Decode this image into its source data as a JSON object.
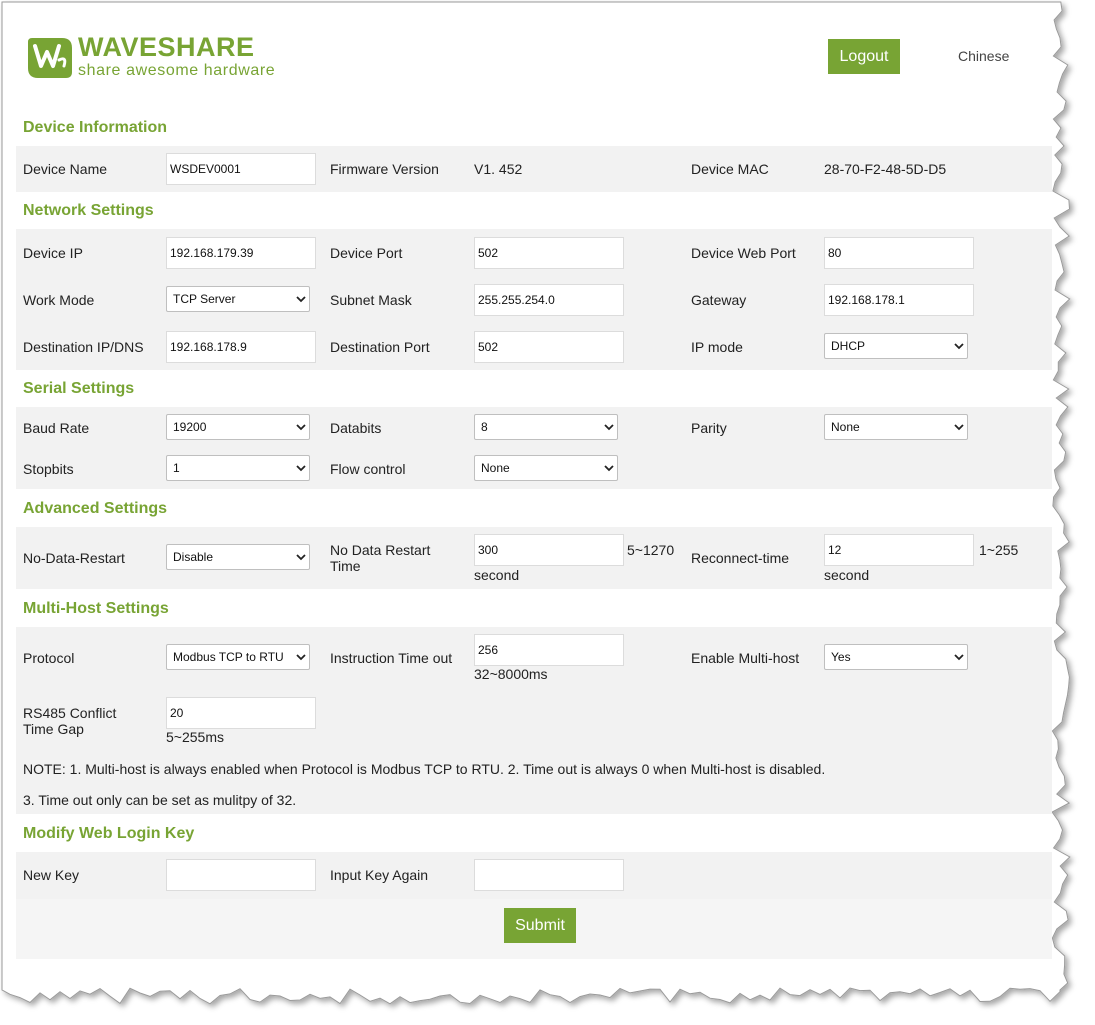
{
  "brand": {
    "title": "WAVESHARE",
    "subtitle": "share awesome hardware",
    "accent": "#78a434"
  },
  "header": {
    "logout_label": "Logout",
    "language_label": "Chinese"
  },
  "device_info": {
    "title": "Device Information",
    "device_name_label": "Device Name",
    "device_name_value": "WSDEV0001",
    "firmware_label": "Firmware Version",
    "firmware_value": "V1. 452",
    "mac_label": "Device MAC",
    "mac_value": "28-70-F2-48-5D-D5"
  },
  "network": {
    "title": "Network Settings",
    "device_ip_label": "Device IP",
    "device_ip_value": "192.168.179.39",
    "device_port_label": "Device Port",
    "device_port_value": "502",
    "web_port_label": "Device Web Port",
    "web_port_value": "80",
    "work_mode_label": "Work Mode",
    "work_mode_value": "TCP Server",
    "subnet_label": "Subnet Mask",
    "subnet_value": "255.255.254.0",
    "gateway_label": "Gateway",
    "gateway_value": "192.168.178.1",
    "dest_ip_label": "Destination IP/DNS",
    "dest_ip_value": "192.168.178.9",
    "dest_port_label": "Destination Port",
    "dest_port_value": "502",
    "ip_mode_label": "IP mode",
    "ip_mode_value": "DHCP"
  },
  "serial": {
    "title": "Serial Settings",
    "baud_label": "Baud Rate",
    "baud_value": "19200",
    "databits_label": "Databits",
    "databits_value": "8",
    "parity_label": "Parity",
    "parity_value": "None",
    "stopbits_label": "Stopbits",
    "stopbits_value": "1",
    "flow_label": "Flow control",
    "flow_value": "None"
  },
  "advanced": {
    "title": "Advanced Settings",
    "ndr_label": "No-Data-Restart",
    "ndr_value": "Disable",
    "ndr_time_label_1": "No Data Restart",
    "ndr_time_label_2": "Time",
    "ndr_time_value": "300",
    "ndr_time_range": "5~1270",
    "ndr_time_unit": "second",
    "reconnect_label": "Reconnect-time",
    "reconnect_value": "12",
    "reconnect_range": "1~255",
    "reconnect_unit": "second"
  },
  "multihost": {
    "title": "Multi-Host Settings",
    "protocol_label": "Protocol",
    "protocol_value": "Modbus TCP to RTU",
    "timeout_label": "Instruction Time out",
    "timeout_value": "256",
    "timeout_range": "32~8000ms",
    "enable_label": "Enable Multi-host",
    "enable_value": "Yes",
    "conflict_label_1": "RS485 Conflict",
    "conflict_label_2": "Time Gap",
    "conflict_value": "20",
    "conflict_range": "5~255ms",
    "note_1": "NOTE: 1. Multi-host is always enabled when Protocol is Modbus TCP to RTU. 2. Time out is always 0 when Multi-host is disabled.",
    "note_2": "3. Time out only can be set as mulitpy of 32."
  },
  "login_key": {
    "title": "Modify Web Login Key",
    "new_key_label": "New Key",
    "new_key_value": "",
    "again_label": "Input Key Again",
    "again_value": ""
  },
  "submit_label": "Submit"
}
